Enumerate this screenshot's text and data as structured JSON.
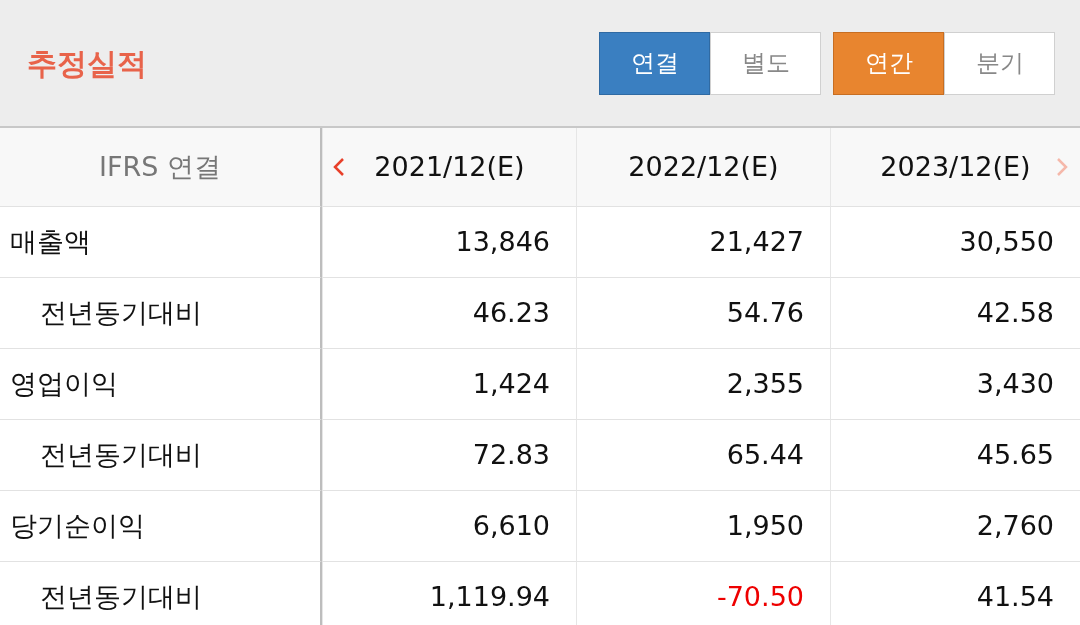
{
  "title": "추정실적",
  "consolidation": [
    {
      "label": "연결",
      "selected": true
    },
    {
      "label": "별도",
      "selected": false
    }
  ],
  "period_type": [
    {
      "label": "연간",
      "selected": true
    },
    {
      "label": "분기",
      "selected": false
    }
  ],
  "table": {
    "corner": "IFRS 연결",
    "prev_disabled": false,
    "next_disabled": true,
    "columns": [
      "2021/12(E)",
      "2022/12(E)",
      "2023/12(E)"
    ],
    "rows": [
      {
        "label": "매출액",
        "values": [
          {
            "text": "13,846",
            "negative": false
          },
          {
            "text": "21,427",
            "negative": false
          },
          {
            "text": "30,550",
            "negative": false
          }
        ],
        "children": [
          {
            "label": "전년동기대비",
            "values": [
              {
                "text": "46.23",
                "negative": false
              },
              {
                "text": "54.76",
                "negative": false
              },
              {
                "text": "42.58",
                "negative": false
              }
            ]
          }
        ]
      },
      {
        "label": "영업이익",
        "values": [
          {
            "text": "1,424",
            "negative": false
          },
          {
            "text": "2,355",
            "negative": false
          },
          {
            "text": "3,430",
            "negative": false
          }
        ],
        "children": [
          {
            "label": "전년동기대비",
            "values": [
              {
                "text": "72.83",
                "negative": false
              },
              {
                "text": "65.44",
                "negative": false
              },
              {
                "text": "45.65",
                "negative": false
              }
            ]
          }
        ]
      },
      {
        "label": "당기순이익",
        "values": [
          {
            "text": "6,610",
            "negative": false
          },
          {
            "text": "1,950",
            "negative": false
          },
          {
            "text": "2,760",
            "negative": false
          }
        ],
        "children": [
          {
            "label": "전년동기대비",
            "values": [
              {
                "text": "1,119.94",
                "negative": false
              },
              {
                "text": "-70.50",
                "negative": true
              },
              {
                "text": "41.54",
                "negative": false
              }
            ]
          }
        ]
      }
    ]
  }
}
